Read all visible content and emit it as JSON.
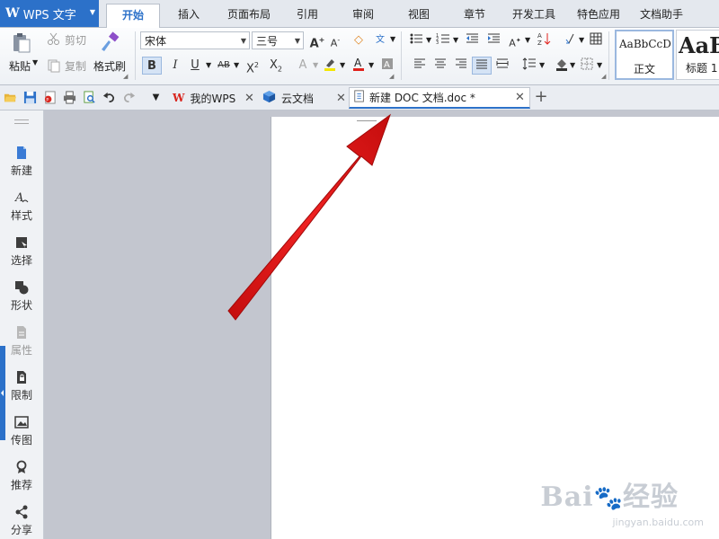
{
  "app": {
    "logo": "W",
    "name": "WPS 文字"
  },
  "menu": {
    "tabs": [
      {
        "label": "开始",
        "active": true
      },
      {
        "label": "插入"
      },
      {
        "label": "页面布局"
      },
      {
        "label": "引用"
      },
      {
        "label": "审阅"
      },
      {
        "label": "视图"
      },
      {
        "label": "章节"
      },
      {
        "label": "开发工具"
      },
      {
        "label": "特色应用"
      },
      {
        "label": "文档助手"
      }
    ]
  },
  "ribbon": {
    "paste_label": "粘贴",
    "cut_label": "剪切",
    "copy_label": "复制",
    "format_painter_label": "格式刷",
    "font_name": "宋体",
    "font_size": "三号",
    "bold": "B",
    "italic": "I",
    "underline": "U",
    "strike": "AB",
    "superscript": "X",
    "subscript": "X",
    "styles": [
      {
        "preview": "AaBbCcD",
        "label": "正文"
      },
      {
        "preview": "AaB",
        "label": "标题 1"
      }
    ]
  },
  "doc_tabs": [
    {
      "label": "我的WPS",
      "icon": "wps-icon"
    },
    {
      "label": "云文档",
      "icon": "cloud-cube-icon"
    },
    {
      "label": "新建 DOC 文档.doc *",
      "icon": "document-icon",
      "active": true
    }
  ],
  "sidebar": {
    "items": [
      {
        "label": "新建",
        "icon": "new-file-icon"
      },
      {
        "label": "样式",
        "icon": "style-icon"
      },
      {
        "label": "选择",
        "icon": "select-icon"
      },
      {
        "label": "形状",
        "icon": "shape-icon"
      },
      {
        "label": "属性",
        "icon": "property-icon",
        "disabled": true
      },
      {
        "label": "限制",
        "icon": "restrict-icon"
      },
      {
        "label": "传图",
        "icon": "upload-image-icon"
      },
      {
        "label": "推荐",
        "icon": "recommend-icon"
      },
      {
        "label": "分享",
        "icon": "share-icon"
      }
    ]
  },
  "watermark": {
    "brand": "Bai",
    "brand2": "经验",
    "url": "jingyan.baidu.com"
  },
  "colors": {
    "accent": "#2c71c9",
    "arrow": "#e81616",
    "font_red": "#e0201b"
  }
}
